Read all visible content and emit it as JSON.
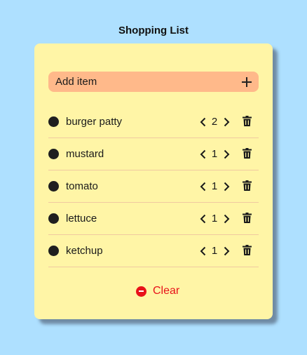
{
  "title": "Shopping List",
  "add_item": {
    "label": "Add item",
    "icon": "plus-icon"
  },
  "items": [
    {
      "name": "burger patty",
      "qty": "2"
    },
    {
      "name": "mustard",
      "qty": "1"
    },
    {
      "name": "tomato",
      "qty": "1"
    },
    {
      "name": "lettuce",
      "qty": "1"
    },
    {
      "name": "ketchup",
      "qty": "1"
    }
  ],
  "clear": {
    "label": "Clear",
    "icon": "minus-circle-icon"
  },
  "colors": {
    "background": "#aee0ff",
    "card": "#fff5a6",
    "add_bar": "#ffb98a",
    "clear": "#e8121a"
  }
}
